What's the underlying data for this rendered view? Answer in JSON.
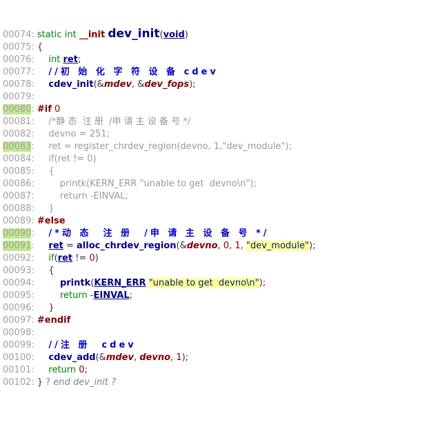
{
  "lines": [
    {
      "n": "00074",
      "hl": false,
      "segs": [
        {
          "c": "kw",
          "t": "static"
        },
        {
          "c": "plain",
          "t": " "
        },
        {
          "c": "type",
          "t": "int"
        },
        {
          "c": "plain",
          "t": " "
        },
        {
          "c": "macro",
          "t": "__init"
        },
        {
          "c": "plain",
          "t": " "
        },
        {
          "c": "fnname",
          "t": "dev_init"
        },
        {
          "c": "punct",
          "t": "("
        },
        {
          "c": "fnlink",
          "t": "void"
        },
        {
          "c": "punct",
          "t": ")"
        }
      ]
    },
    {
      "n": "00075",
      "hl": false,
      "segs": [
        {
          "c": "punct",
          "t": "{"
        }
      ]
    },
    {
      "n": "00076",
      "hl": false,
      "segs": [
        {
          "c": "plain",
          "t": "    "
        },
        {
          "c": "type",
          "t": "int"
        },
        {
          "c": "plain",
          "t": " "
        },
        {
          "c": "id-link",
          "t": "ret"
        },
        {
          "c": "punct",
          "t": ";"
        }
      ]
    },
    {
      "n": "00077",
      "hl": false,
      "segs": [
        {
          "c": "plain",
          "t": "    "
        },
        {
          "c": "comment-blue",
          "t": "//初 始 化 字 符 设 备 cdev"
        }
      ]
    },
    {
      "n": "00078",
      "hl": false,
      "segs": [
        {
          "c": "plain",
          "t": "    "
        },
        {
          "c": "call",
          "t": "cdev_init"
        },
        {
          "c": "punct",
          "t": "(&"
        },
        {
          "c": "param",
          "t": "mdev"
        },
        {
          "c": "punct",
          "t": ", &"
        },
        {
          "c": "param",
          "t": "dev_fops"
        },
        {
          "c": "punct",
          "t": ");"
        }
      ]
    },
    {
      "n": "00079",
      "hl": false,
      "segs": [
        {
          "c": "plain",
          "t": ""
        }
      ]
    },
    {
      "n": "00080",
      "hl": true,
      "segs": [
        {
          "c": "macro",
          "t": "#if"
        },
        {
          "c": "plain",
          "t": " "
        },
        {
          "c": "num",
          "t": "0"
        }
      ]
    },
    {
      "n": "00081",
      "hl": false,
      "segs": [
        {
          "c": "dead",
          "t": "    /*静 态  注 册  /申 请 主 设 备 号 */"
        }
      ]
    },
    {
      "n": "00082",
      "hl": false,
      "segs": [
        {
          "c": "dead",
          "t": "    devno = 251;"
        }
      ]
    },
    {
      "n": "00083",
      "hl": true,
      "segs": [
        {
          "c": "dead",
          "t": "    ret = register_chrdev_region(devno, 1,\"dev_module\");"
        }
      ]
    },
    {
      "n": "00084",
      "hl": false,
      "segs": [
        {
          "c": "dead",
          "t": "    if(ret != 0)"
        }
      ]
    },
    {
      "n": "00085",
      "hl": false,
      "segs": [
        {
          "c": "dead",
          "t": "    {"
        }
      ]
    },
    {
      "n": "00086",
      "hl": false,
      "segs": [
        {
          "c": "dead",
          "t": "        printk(KERN_ERR \"unable to get  devno\\n\");"
        }
      ]
    },
    {
      "n": "00087",
      "hl": false,
      "segs": [
        {
          "c": "dead",
          "t": "        return -EINVAL;"
        }
      ]
    },
    {
      "n": "00088",
      "hl": false,
      "segs": [
        {
          "c": "dead",
          "t": "    }"
        }
      ]
    },
    {
      "n": "00089",
      "hl": false,
      "segs": [
        {
          "c": "macro",
          "t": "#else"
        }
      ]
    },
    {
      "n": "00090",
      "hl": true,
      "segs": [
        {
          "c": "plain",
          "t": "    "
        },
        {
          "c": "comment-blue",
          "t": "/*动 态  注 册  /申 请 主 设 备 号 */"
        }
      ]
    },
    {
      "n": "00091",
      "hl": true,
      "segs": [
        {
          "c": "plain",
          "t": "    "
        },
        {
          "c": "id-link",
          "t": "ret"
        },
        {
          "c": "plain",
          "t": " = "
        },
        {
          "c": "call",
          "t": "alloc_chrdev_region"
        },
        {
          "c": "punct",
          "t": "(&"
        },
        {
          "c": "param",
          "t": "devno"
        },
        {
          "c": "punct",
          "t": ", "
        },
        {
          "c": "num",
          "t": "0"
        },
        {
          "c": "punct",
          "t": ", "
        },
        {
          "c": "num",
          "t": "1"
        },
        {
          "c": "punct",
          "t": ", "
        },
        {
          "c": "str-hl",
          "t": "\"dev_module\""
        },
        {
          "c": "punct",
          "t": ");"
        }
      ]
    },
    {
      "n": "00092",
      "hl": false,
      "segs": [
        {
          "c": "plain",
          "t": "    "
        },
        {
          "c": "kw",
          "t": "if"
        },
        {
          "c": "punct",
          "t": "("
        },
        {
          "c": "id-link",
          "t": "ret"
        },
        {
          "c": "plain",
          "t": " != "
        },
        {
          "c": "num",
          "t": "0"
        },
        {
          "c": "punct",
          "t": ")"
        }
      ]
    },
    {
      "n": "00093",
      "hl": false,
      "segs": [
        {
          "c": "plain",
          "t": "    "
        },
        {
          "c": "punct",
          "t": "{"
        }
      ]
    },
    {
      "n": "00094",
      "hl": false,
      "segs": [
        {
          "c": "plain",
          "t": "        "
        },
        {
          "c": "call",
          "t": "printk"
        },
        {
          "c": "punct",
          "t": "("
        },
        {
          "c": "id-link",
          "t": "KERN_ERR"
        },
        {
          "c": "plain",
          "t": " "
        },
        {
          "c": "str-hl",
          "t": "\"unable to get  devno\\n\""
        },
        {
          "c": "punct",
          "t": ");"
        }
      ]
    },
    {
      "n": "00095",
      "hl": false,
      "segs": [
        {
          "c": "plain",
          "t": "        "
        },
        {
          "c": "kw",
          "t": "return"
        },
        {
          "c": "plain",
          "t": " -"
        },
        {
          "c": "id-link",
          "t": "EINVAL"
        },
        {
          "c": "punct",
          "t": ";"
        }
      ]
    },
    {
      "n": "00096",
      "hl": false,
      "segs": [
        {
          "c": "plain",
          "t": "    "
        },
        {
          "c": "punct",
          "t": "}"
        }
      ]
    },
    {
      "n": "00097",
      "hl": false,
      "segs": [
        {
          "c": "macro",
          "t": "#endif"
        }
      ]
    },
    {
      "n": "00098",
      "hl": false,
      "segs": [
        {
          "c": "plain",
          "t": ""
        }
      ]
    },
    {
      "n": "00099",
      "hl": false,
      "segs": [
        {
          "c": "plain",
          "t": "    "
        },
        {
          "c": "comment-blue",
          "t": "//注 册  cdev"
        }
      ]
    },
    {
      "n": "00100",
      "hl": false,
      "segs": [
        {
          "c": "plain",
          "t": "    "
        },
        {
          "c": "call",
          "t": "cdev_add"
        },
        {
          "c": "punct",
          "t": "(&"
        },
        {
          "c": "param",
          "t": "mdev"
        },
        {
          "c": "punct",
          "t": ", "
        },
        {
          "c": "param",
          "t": "devno"
        },
        {
          "c": "punct",
          "t": ", "
        },
        {
          "c": "num",
          "t": "1"
        },
        {
          "c": "punct",
          "t": ");"
        }
      ]
    },
    {
      "n": "00101",
      "hl": false,
      "segs": [
        {
          "c": "plain",
          "t": "    "
        },
        {
          "c": "kw",
          "t": "return"
        },
        {
          "c": "plain",
          "t": " "
        },
        {
          "c": "num",
          "t": "0"
        },
        {
          "c": "punct",
          "t": ";"
        }
      ]
    },
    {
      "n": "00102",
      "hl": false,
      "segs": [
        {
          "c": "punct",
          "t": "}"
        },
        {
          "c": "comment-plain",
          "t": " ? "
        },
        {
          "c": "comment-end",
          "t": "end dev_init ?"
        }
      ]
    }
  ]
}
